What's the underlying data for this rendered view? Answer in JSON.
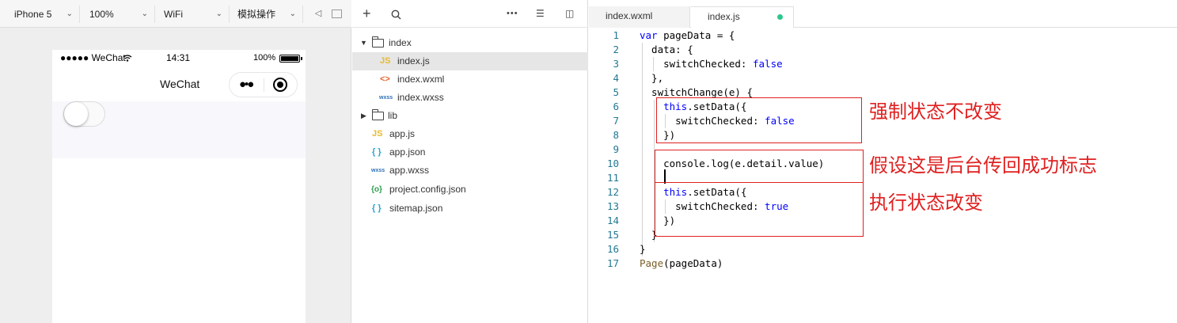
{
  "simulator": {
    "toolbar": {
      "device": "iPhone 5",
      "zoom": "100%",
      "network": "WiFi",
      "operation": "模拟操作"
    },
    "status_bar": {
      "carrier": "●●●●● WeChat",
      "time": "14:31",
      "battery_text": "100%",
      "battery_level": 1.0
    },
    "nav_title": "WeChat",
    "switch_checked": false
  },
  "files": {
    "tree": [
      {
        "name": "index",
        "type": "folder",
        "expanded": true
      },
      {
        "name": "index.js",
        "type": "js",
        "icon": "JS",
        "selected": true
      },
      {
        "name": "index.wxml",
        "type": "wxml",
        "icon": "<>"
      },
      {
        "name": "index.wxss",
        "type": "wxss",
        "icon": "wxss"
      },
      {
        "name": "lib",
        "type": "folder",
        "expanded": false
      },
      {
        "name": "app.js",
        "type": "js",
        "icon": "JS"
      },
      {
        "name": "app.json",
        "type": "json",
        "icon": "{ }"
      },
      {
        "name": "app.wxss",
        "type": "wxss",
        "icon": "wxss"
      },
      {
        "name": "project.config.json",
        "type": "config",
        "icon": "{o}"
      },
      {
        "name": "sitemap.json",
        "type": "json",
        "icon": "{ }"
      }
    ]
  },
  "editor": {
    "tabs": [
      {
        "label": "index.wxml",
        "active": false
      },
      {
        "label": "index.js",
        "active": true,
        "modified": true
      }
    ],
    "lines": [
      {
        "n": "1",
        "code": "var pageData = {"
      },
      {
        "n": "2",
        "code": "  data: {"
      },
      {
        "n": "3",
        "code": "    switchChecked: false"
      },
      {
        "n": "4",
        "code": "  },"
      },
      {
        "n": "5",
        "code": "  switchChange(e) {"
      },
      {
        "n": "6",
        "code": "    this.setData({"
      },
      {
        "n": "7",
        "code": "      switchChecked: false"
      },
      {
        "n": "8",
        "code": "    })"
      },
      {
        "n": "9",
        "code": ""
      },
      {
        "n": "10",
        "code": "    console.log(e.detail.value)"
      },
      {
        "n": "11",
        "code": ""
      },
      {
        "n": "12",
        "code": "    this.setData({"
      },
      {
        "n": "13",
        "code": "      switchChecked: true"
      },
      {
        "n": "14",
        "code": "    })"
      },
      {
        "n": "15",
        "code": "  }"
      },
      {
        "n": "16",
        "code": "}"
      },
      {
        "n": "17",
        "code": "Page(pageData)"
      }
    ],
    "annotations": [
      "强制状态不改变",
      "假设这是后台传回成功标志",
      "执行状态改变"
    ]
  },
  "colors": {
    "annotation": "#e02020",
    "keyword": "#0000ff",
    "line_number": "#237893",
    "modified_dot": "#2bc88c"
  }
}
